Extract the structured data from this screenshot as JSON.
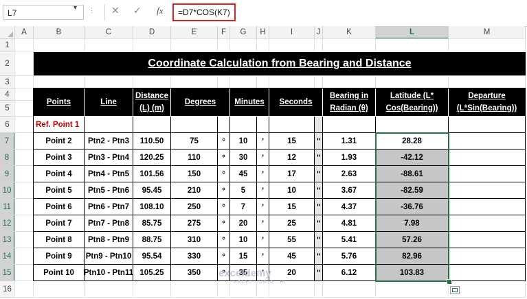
{
  "formula_bar": {
    "name_box": "L7",
    "formula": "=D7*COS(K7)",
    "cancel_icon": "close-icon",
    "enter_icon": "check-icon",
    "fx_label": "fx"
  },
  "columns": [
    "A",
    "B",
    "C",
    "D",
    "E",
    "F",
    "G",
    "H",
    "I",
    "J",
    "K",
    "L",
    "M"
  ],
  "rows": [
    "1",
    "2",
    "3",
    "4",
    "5",
    "6",
    "7",
    "8",
    "9",
    "10",
    "11",
    "12",
    "13",
    "14",
    "15",
    "16"
  ],
  "title": "Coordinate Calculation from Bearing and Distance",
  "headers": {
    "points": "Points",
    "line": "Line",
    "distance": "Distance (L) (m)",
    "degrees": "Degrees",
    "minutes": "Minutes",
    "seconds": "Seconds",
    "bearing": "Bearing in Radian (θ)",
    "latitude": "Latitude (L* Cos(Bearing))",
    "departure": "Departure (L*Sin(Bearing))"
  },
  "ref_point": "Ref. Point 1",
  "symbols": {
    "degree": "°",
    "minute": "’",
    "second": "\""
  },
  "table": [
    {
      "point": "Point 2",
      "line": "Ptn2 - Ptn3",
      "distance": "110.50",
      "deg": "75",
      "min": "10",
      "sec": "15",
      "rad": "1.31",
      "lat": "28.28"
    },
    {
      "point": "Point 3",
      "line": "Ptn3 - Ptn4",
      "distance": "120.25",
      "deg": "110",
      "min": "30",
      "sec": "12",
      "rad": "1.93",
      "lat": "-42.12"
    },
    {
      "point": "Point 4",
      "line": "Ptn4 - Ptn5",
      "distance": "101.56",
      "deg": "150",
      "min": "45",
      "sec": "17",
      "rad": "2.63",
      "lat": "-88.61"
    },
    {
      "point": "Point 5",
      "line": "Ptn5 - Ptn6",
      "distance": "95.45",
      "deg": "210",
      "min": "5",
      "sec": "10",
      "rad": "3.67",
      "lat": "-82.59"
    },
    {
      "point": "Point 6",
      "line": "Ptn6 - Ptn7",
      "distance": "108.10",
      "deg": "250",
      "min": "7",
      "sec": "15",
      "rad": "4.37",
      "lat": "-36.76"
    },
    {
      "point": "Point 7",
      "line": "Ptn7 - Ptn8",
      "distance": "85.75",
      "deg": "275",
      "min": "20",
      "sec": "25",
      "rad": "4.81",
      "lat": "7.98"
    },
    {
      "point": "Point 8",
      "line": "Ptn8 - Ptn9",
      "distance": "88.75",
      "deg": "310",
      "min": "10",
      "sec": "55",
      "rad": "5.41",
      "lat": "57.26"
    },
    {
      "point": "Point 9",
      "line": "Ptn9 - Ptn10",
      "distance": "95.54",
      "deg": "330",
      "min": "15",
      "sec": "45",
      "rad": "5.76",
      "lat": "82.96"
    },
    {
      "point": "Point 10",
      "line": "Ptn10 - Ptn11",
      "distance": "105.25",
      "deg": "350",
      "min": "35",
      "sec": "20",
      "rad": "6.12",
      "lat": "103.83"
    }
  ],
  "watermark": {
    "brand": "exceldemy",
    "tagline": "EXCEL · DATA · BI"
  },
  "colors": {
    "selection": "#217346",
    "header_bg": "#000000",
    "selected_fill": "#c6c6c6",
    "ref_text": "#c00000",
    "formula_highlight": "#e02020"
  }
}
